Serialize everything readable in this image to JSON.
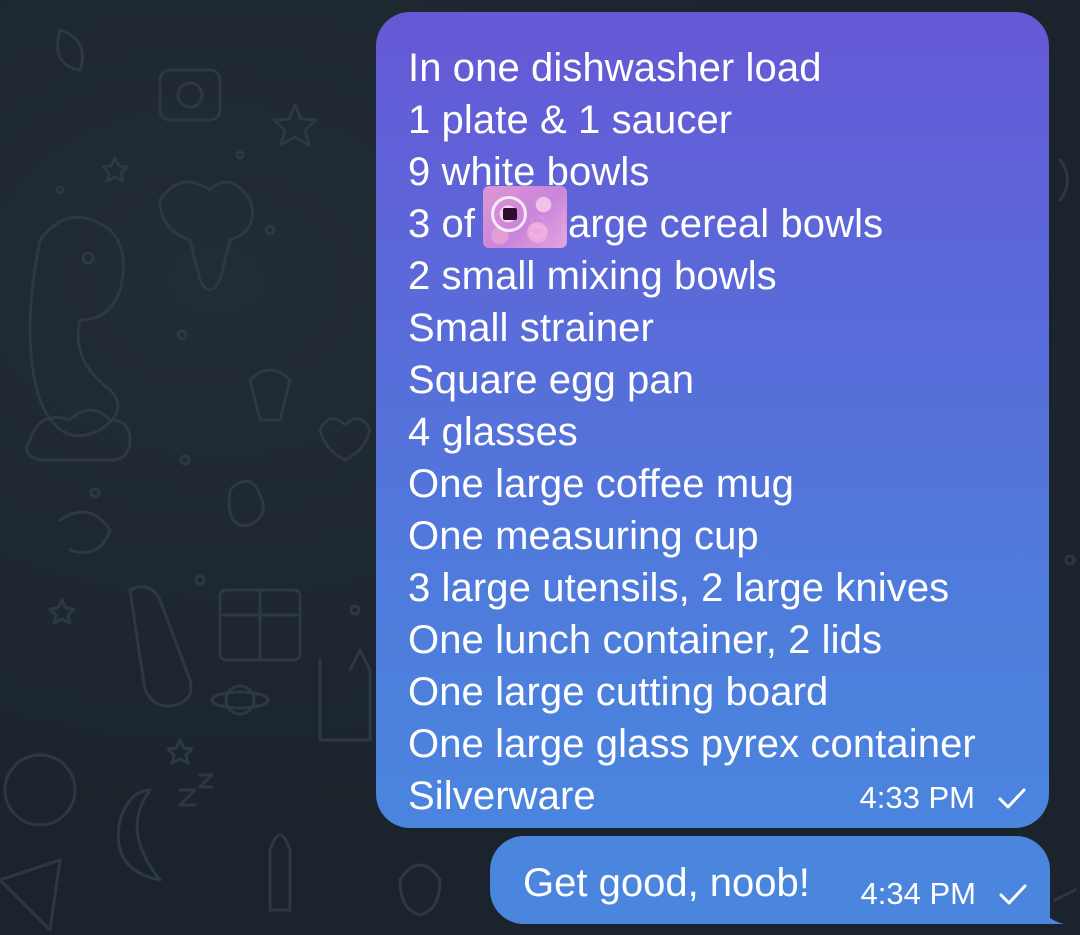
{
  "messages": [
    {
      "lines": [
        "In one dishwasher load",
        "1 plate & 1 saucer",
        "9 white bowls",
        "3 of    's large cereal bowls",
        "2 small mixing bowls",
        "Small strainer",
        "Square egg pan",
        "4 glasses",
        "One large coffee mug",
        "One measuring cup",
        "3 large utensils, 2 large knives",
        "One lunch container, 2 lids",
        "One large cutting board",
        "One large glass pyrex container",
        "Silverware"
      ],
      "time": "4:33 PM",
      "status_icon": "single-check-icon"
    },
    {
      "text": "Get good, noob!",
      "time": "4:34 PM",
      "status_icon": "single-check-icon"
    }
  ],
  "colors": {
    "background": "#1b242c",
    "bubble_top": "#6658d6",
    "bubble_bottom": "#4a85de",
    "text": "#ffffff"
  },
  "redaction": {
    "icon": "pixelated-name-redaction"
  }
}
